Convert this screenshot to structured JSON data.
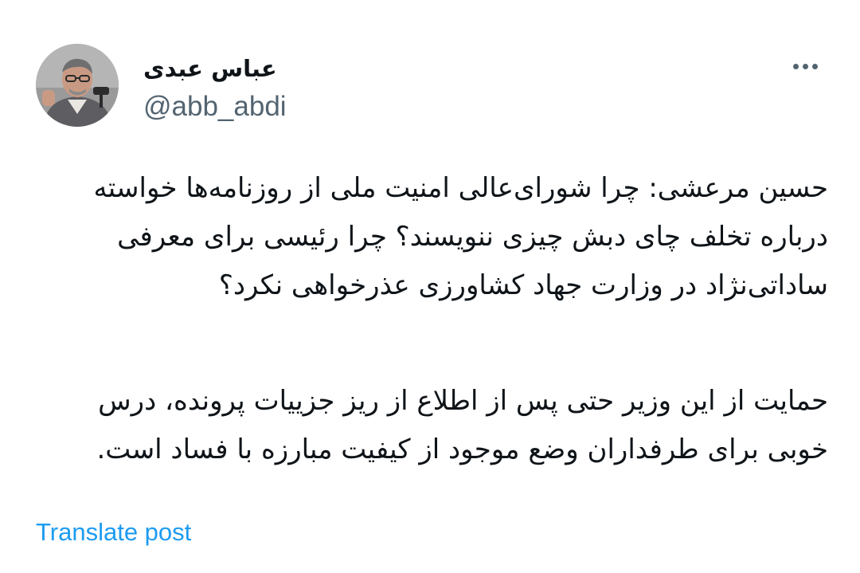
{
  "author": {
    "display_name": "عباس عبدی",
    "handle": "@abb_abdi",
    "avatar_icon": "person-avatar"
  },
  "header": {
    "more_icon": "more-horizontal-icon"
  },
  "tweet": {
    "paragraph_1": "حسین مرعشی: چرا شورای‌عالی امنیت ملی از روزنامه‌ها خواسته درباره تخلف چای دبش چیزی ننویسند؟ چرا رئیسی برای معرفی ساداتی‌نژاد در وزارت جهاد کشاورزی عذرخواهی نکرد؟",
    "paragraph_2": "حمایت از این وزیر حتی پس از اطلاع از ریز جزییات پرونده، درس خوبی برای طرفداران وضع موجود از کیفیت مبارزه با فساد است."
  },
  "actions": {
    "translate_label": "Translate post"
  },
  "colors": {
    "text": "#0f1419",
    "secondary": "#536471",
    "link": "#1d9bf0"
  }
}
